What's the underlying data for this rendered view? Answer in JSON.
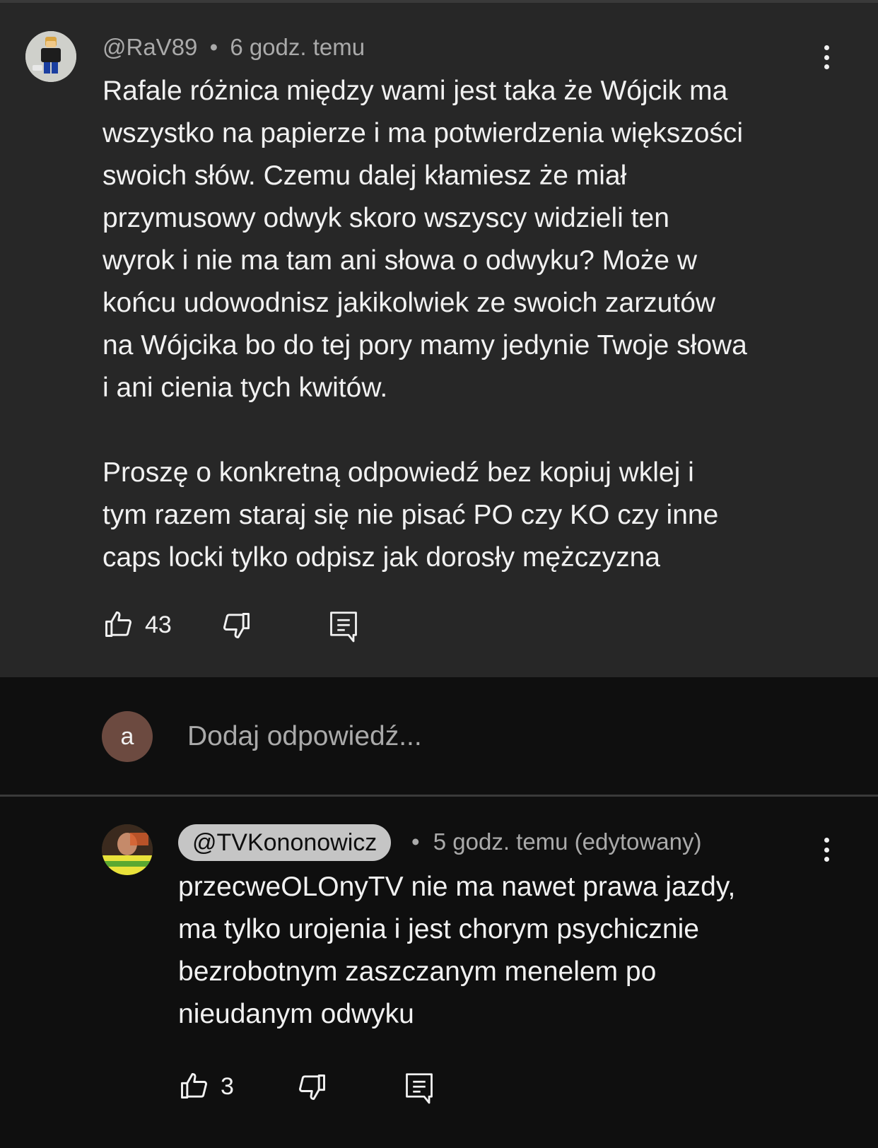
{
  "comment": {
    "author": "@RaV89",
    "separator": "•",
    "time": "6 godz. temu",
    "text": "Rafale różnica między wami jest taka że Wójcik ma\nwszystko na papierze i ma potwierdzenia większości\nswoich słów. Czemu dalej kłamiesz że miał\nprzymusowy odwyk skoro wszyscy widzieli ten\nwyrok i nie ma tam ani słowa o odwyku? Może w\nkońcu udowodnisz jakikolwiek ze swoich zarzutów\nna Wójcika bo do tej pory mamy jedynie Twoje słowa\ni ani cienia tych kwitów.\n\nProszę o konkretną odpowiedź bez kopiuj wklej i\ntym razem staraj się nie pisać PO czy KO czy inne\ncaps locki tylko odpisz jak dorosły mężczyzna",
    "likes": "43"
  },
  "reply_box": {
    "avatar_letter": "a",
    "placeholder": "Dodaj odpowiedź..."
  },
  "reply": {
    "author": "@TVKononowicz",
    "separator": "•",
    "time": "5 godz. temu (edytowany)",
    "text": "przecweOLOnyTV nie ma nawet prawa jazdy,\nma tylko urojenia i jest chorym psychicznie\nbezrobotnym zaszczanym menelem po\nnieudanym odwyku",
    "likes": "3"
  },
  "icons": {
    "like": "thumbs-up-icon",
    "dislike": "thumbs-down-icon",
    "reply": "reply-comment-icon",
    "more": "more-vertical-icon"
  }
}
